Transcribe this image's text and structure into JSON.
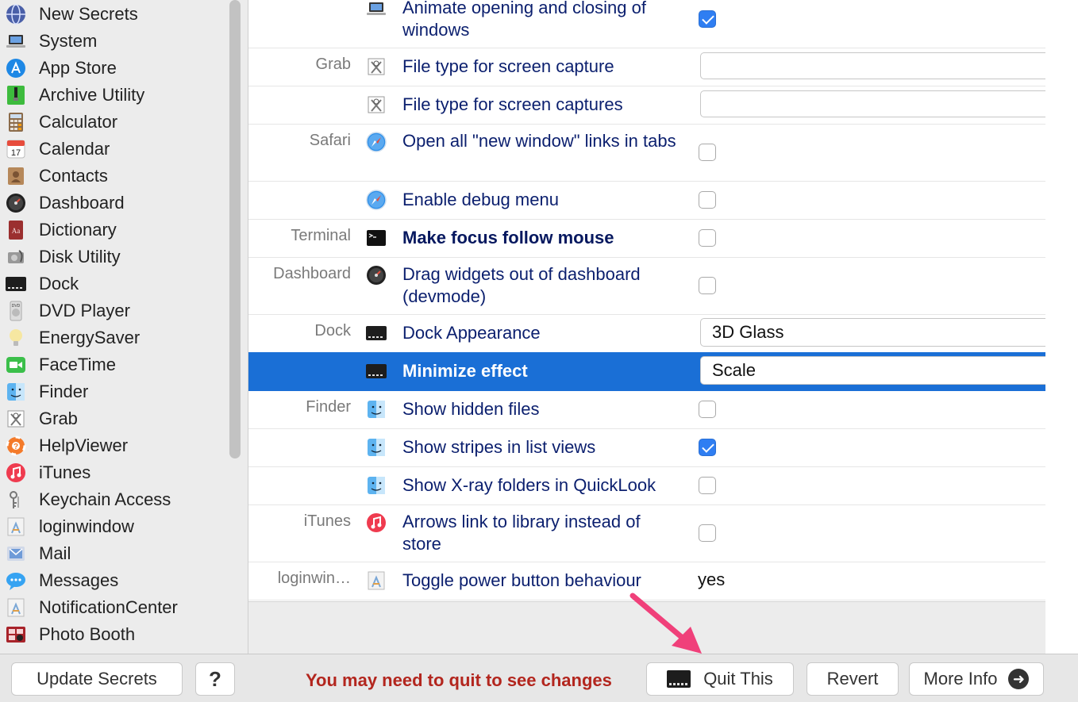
{
  "sidebar": {
    "items": [
      {
        "label": "New Secrets",
        "icon": "globe-icon"
      },
      {
        "label": "System",
        "icon": "laptop-icon"
      },
      {
        "label": "App Store",
        "icon": "app-store-icon"
      },
      {
        "label": "Archive Utility",
        "icon": "archive-icon"
      },
      {
        "label": "Calculator",
        "icon": "calculator-icon"
      },
      {
        "label": "Calendar",
        "icon": "calendar-icon"
      },
      {
        "label": "Contacts",
        "icon": "contacts-icon"
      },
      {
        "label": "Dashboard",
        "icon": "dashboard-icon"
      },
      {
        "label": "Dictionary",
        "icon": "dictionary-icon"
      },
      {
        "label": "Disk Utility",
        "icon": "disk-utility-icon"
      },
      {
        "label": "Dock",
        "icon": "dock-icon"
      },
      {
        "label": "DVD Player",
        "icon": "dvd-icon"
      },
      {
        "label": "EnergySaver",
        "icon": "lightbulb-icon"
      },
      {
        "label": "FaceTime",
        "icon": "facetime-icon"
      },
      {
        "label": "Finder",
        "icon": "finder-icon"
      },
      {
        "label": "Grab",
        "icon": "grab-icon"
      },
      {
        "label": "HelpViewer",
        "icon": "lifebuoy-icon"
      },
      {
        "label": "iTunes",
        "icon": "itunes-icon"
      },
      {
        "label": "Keychain Access",
        "icon": "keychain-icon"
      },
      {
        "label": "loginwindow",
        "icon": "app-generic-icon"
      },
      {
        "label": "Mail",
        "icon": "mail-icon"
      },
      {
        "label": "Messages",
        "icon": "messages-icon"
      },
      {
        "label": "NotificationCenter",
        "icon": "app-generic-icon"
      },
      {
        "label": "Photo Booth",
        "icon": "photo-booth-icon"
      }
    ]
  },
  "table": {
    "rows": [
      {
        "app": "",
        "label": "Animate opening and closing of windows",
        "icon": "laptop-icon",
        "control": "checkbox",
        "checked": true
      },
      {
        "app": "Grab",
        "label": "File type for screen capture",
        "icon": "grab-icon",
        "control": "field",
        "value": ""
      },
      {
        "app": "",
        "label": "File type for screen captures",
        "icon": "grab-icon",
        "control": "field",
        "value": ""
      },
      {
        "app": "Safari",
        "label": "Open all \"new window\" links in tabs",
        "icon": "safari-icon",
        "control": "checkbox",
        "checked": false
      },
      {
        "app": "",
        "label": "Enable debug menu",
        "icon": "safari-icon",
        "control": "checkbox",
        "checked": false
      },
      {
        "app": "Terminal",
        "label": "Make focus follow mouse",
        "icon": "terminal-icon",
        "control": "checkbox",
        "checked": false,
        "bold": true
      },
      {
        "app": "Dashboard",
        "label": "Drag widgets out of dashboard (devmode)",
        "icon": "dashboard-icon",
        "control": "checkbox",
        "checked": false
      },
      {
        "app": "Dock",
        "label": "Dock Appearance",
        "icon": "dock-icon",
        "control": "select",
        "value": "3D Glass"
      },
      {
        "app": "",
        "label": "Minimize effect",
        "icon": "dock-icon",
        "control": "select",
        "value": "Scale",
        "selected": true
      },
      {
        "app": "Finder",
        "label": "Show hidden files",
        "icon": "finder-icon",
        "control": "checkbox",
        "checked": false
      },
      {
        "app": "",
        "label": "Show stripes in list views",
        "icon": "finder-icon",
        "control": "checkbox",
        "checked": true
      },
      {
        "app": "",
        "label": "Show X-ray folders in QuickLook",
        "icon": "finder-icon",
        "control": "checkbox",
        "checked": false
      },
      {
        "app": "iTunes",
        "label": "Arrows link to library instead of store",
        "icon": "itunes-icon",
        "control": "checkbox",
        "checked": false
      },
      {
        "app": "loginwin…",
        "label": "Toggle power button behaviour",
        "icon": "app-generic-icon",
        "control": "text",
        "value": "yes"
      }
    ]
  },
  "bottom": {
    "update_label": "Update Secrets",
    "help_label": "?",
    "warning": "You may need to quit to see changes",
    "quit_label": "Quit This",
    "revert_label": "Revert",
    "more_info_label": "More Info"
  },
  "colors": {
    "selection": "#1a6fd6",
    "warning": "#b3261e",
    "checkbox_on": "#2f7ef2",
    "annotation_arrow": "#f0407a",
    "label_text": "#0b1f6e"
  }
}
